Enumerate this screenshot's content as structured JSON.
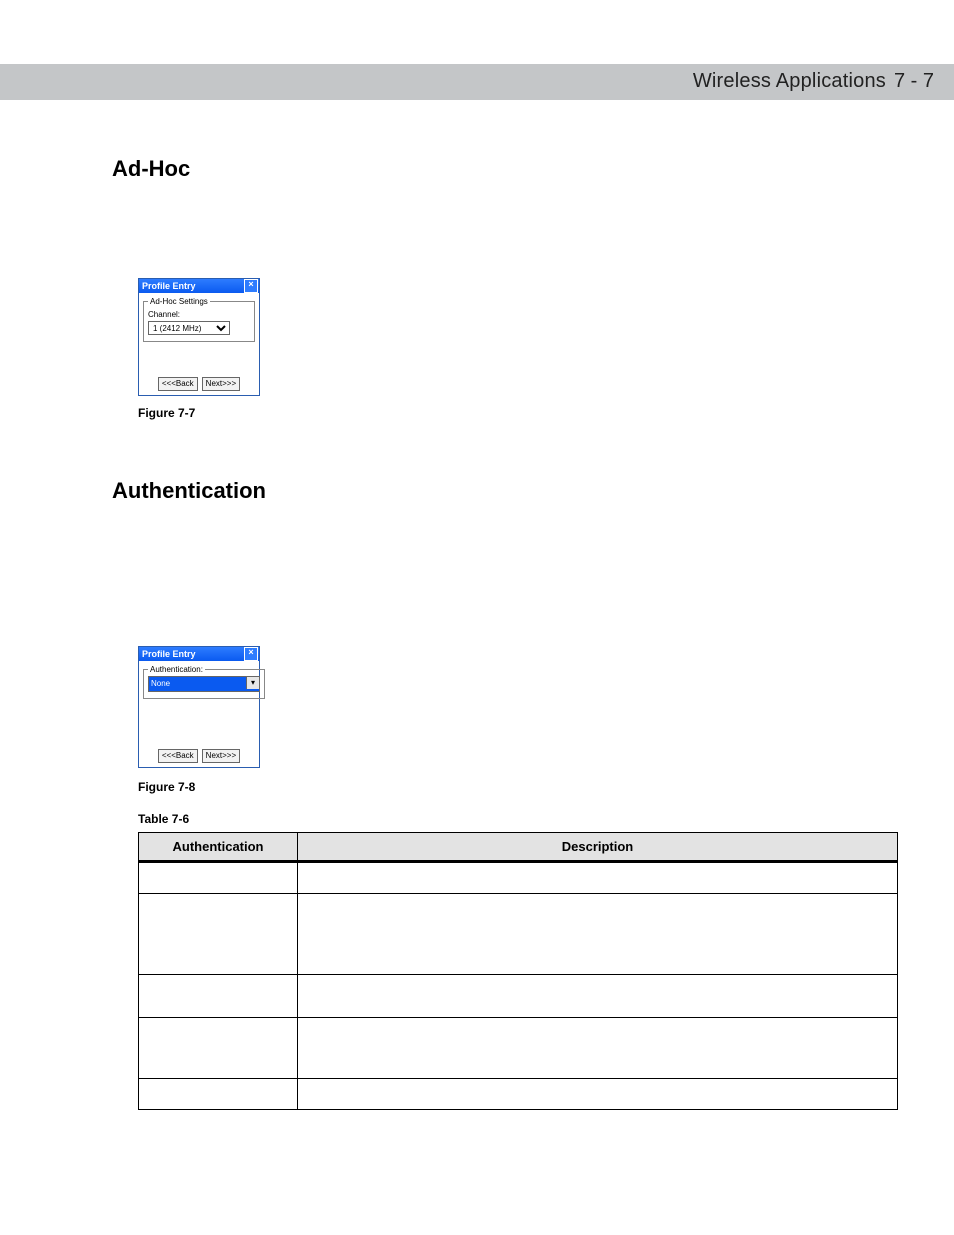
{
  "header": {
    "title": "Wireless Applications",
    "page": "7 - 7"
  },
  "sections": {
    "adhoc_heading": "Ad-Hoc",
    "auth_heading": "Authentication"
  },
  "dialog1": {
    "title": "Profile Entry",
    "close": "×",
    "group_label": "Ad-Hoc Settings",
    "channel_label": "Channel:",
    "channel_value": "1 (2412 MHz)",
    "back_label": "<<<Back",
    "next_label": "Next>>>"
  },
  "dialog2": {
    "title": "Profile Entry",
    "close": "×",
    "group_label": "Authentication:",
    "value": "None",
    "back_label": "<<<Back",
    "next_label": "Next>>>"
  },
  "captions": {
    "fig77": "Figure 7-7",
    "fig78": "Figure 7-8",
    "tab76": "Table 7-6"
  },
  "table": {
    "col1": "Authentication",
    "col2": "Description",
    "rows": [
      {
        "auth": "",
        "desc": ""
      },
      {
        "auth": "",
        "desc": ""
      },
      {
        "auth": "",
        "desc": ""
      },
      {
        "auth": "",
        "desc": ""
      },
      {
        "auth": "",
        "desc": ""
      }
    ]
  }
}
